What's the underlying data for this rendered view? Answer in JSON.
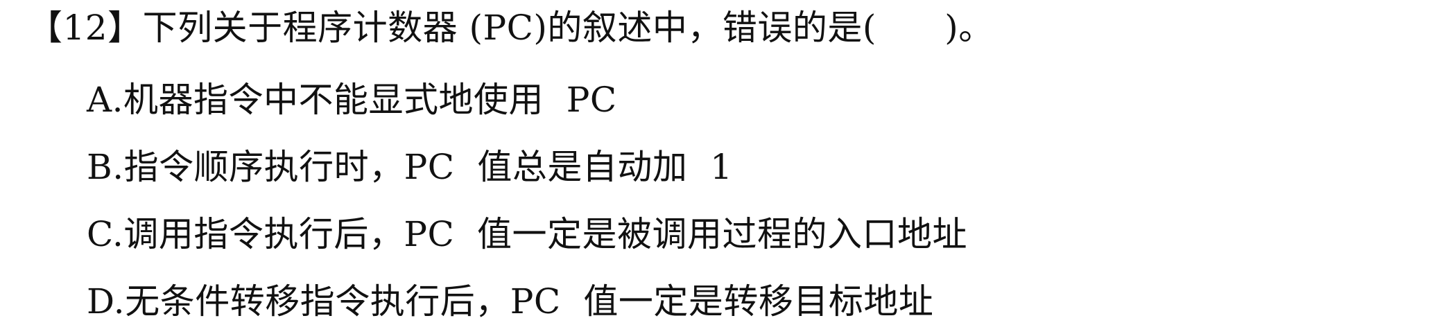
{
  "question": {
    "stem": "【12】下列关于程序计数器 (PC)的叙述中，错误的是(      )。",
    "options": [
      {
        "text": "A.机器指令中不能显式地使用  PC"
      },
      {
        "text": "B.指令顺序执行时，PC  值总是自动加  1"
      },
      {
        "text": "C.调用指令执行后，PC  值一定是被调用过程的入口地址"
      },
      {
        "text": "D.无条件转移指令执行后，PC  值一定是转移目标地址"
      }
    ]
  }
}
